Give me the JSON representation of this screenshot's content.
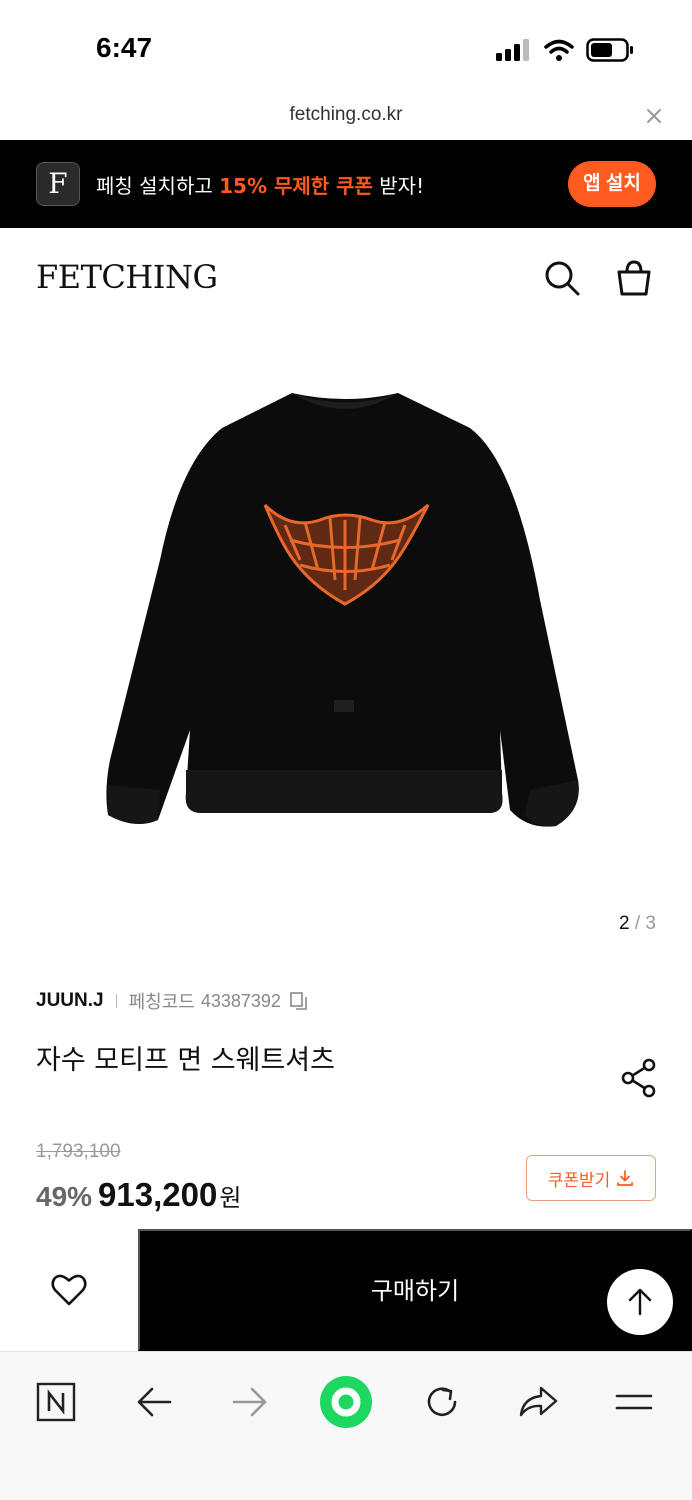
{
  "status_bar": {
    "time": "6:47"
  },
  "url_bar": {
    "domain": "fetching.co.kr"
  },
  "promo": {
    "logo_letter": "F",
    "text_before": "페칭 설치하고 ",
    "text_highlight": "15% 무제한 쿠폰",
    "text_after": " 받자!",
    "button_label": "앱 설치",
    "accent_color": "#ff5a1f"
  },
  "header": {
    "logo": "FETCHING",
    "icons": [
      "search-icon",
      "shopping-bag-icon"
    ]
  },
  "product": {
    "image_counter_current": "2",
    "image_counter_sep": " / ",
    "image_counter_total": "3",
    "brand": "JUUN.J",
    "code_label": "페칭코드",
    "code": "43387392",
    "title": "자수 모티프 면 스웨트셔츠",
    "original_price": "1,793,100",
    "discount": "49%",
    "price": "913,200",
    "currency": "원",
    "coupon_label": "쿠폰받기"
  },
  "buy_bar": {
    "buy_label": "구매하기"
  },
  "toolbar": {
    "icons": [
      "naver-icon",
      "back-arrow-icon",
      "forward-arrow-icon",
      "home-green-icon",
      "reload-icon",
      "share-arrow-icon",
      "menu-icon"
    ]
  }
}
